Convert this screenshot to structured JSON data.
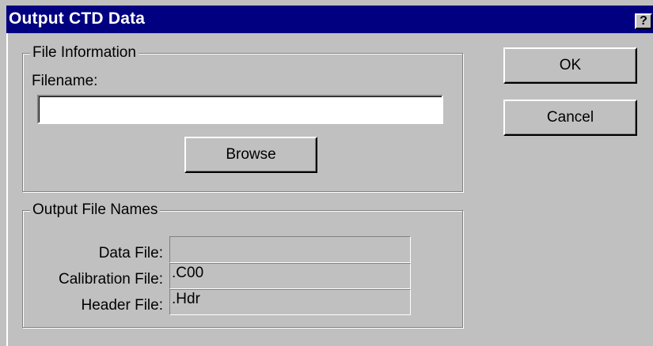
{
  "dialog": {
    "title": "Output CTD Data",
    "help_glyph": "?",
    "close_glyph": "✕"
  },
  "file_information": {
    "group_label": "File Information",
    "filename_label": "Filename:",
    "filename_value": "",
    "browse_label": "Browse"
  },
  "output_file_names": {
    "group_label": "Output File Names",
    "rows": [
      {
        "label": "Data File:",
        "value": ""
      },
      {
        "label": "Calibration File:",
        "value": ".C00"
      },
      {
        "label": "Header File:",
        "value": ".Hdr"
      }
    ]
  },
  "buttons": {
    "ok_label": "OK",
    "cancel_label": "Cancel"
  }
}
